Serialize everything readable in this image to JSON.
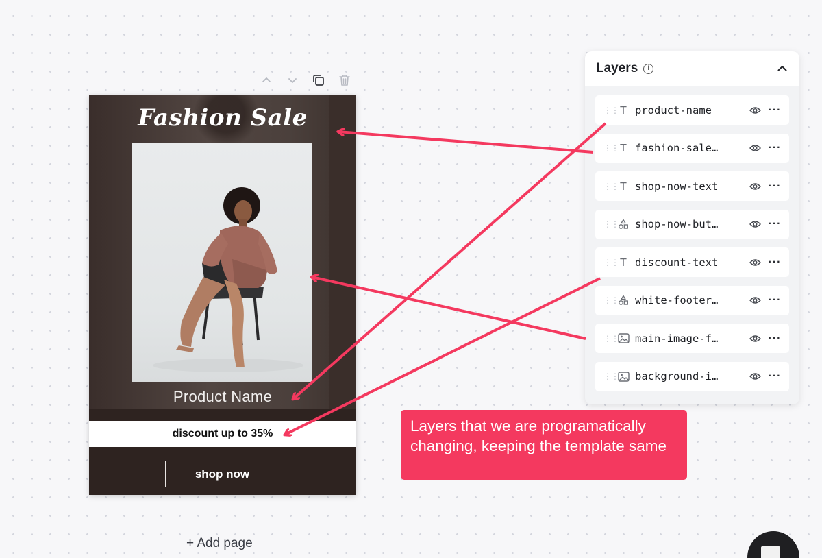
{
  "canvas": {
    "add_page_label": "+ Add page"
  },
  "design": {
    "title": "Fashion Sale",
    "product_name": "Product Name",
    "discount_text": "discount up to 35%",
    "button_label": "shop now"
  },
  "toolbar": {
    "icons": [
      "chevron-up-icon",
      "chevron-down-icon",
      "duplicate-icon",
      "trash-icon"
    ]
  },
  "layers": {
    "title": "Layers",
    "items": [
      {
        "type": "text",
        "name": "product-name"
      },
      {
        "type": "text",
        "name": "fashion-sale…"
      },
      {
        "type": "text",
        "name": "shop-now-text"
      },
      {
        "type": "shape",
        "name": "shop-now-but…"
      },
      {
        "type": "text",
        "name": "discount-text"
      },
      {
        "type": "shape",
        "name": "white-footer…"
      },
      {
        "type": "image",
        "name": "main-image-f…"
      },
      {
        "type": "image",
        "name": "background-i…"
      }
    ]
  },
  "callout": {
    "text": "Layers that we are programatically changing, keeping the template same"
  },
  "colors": {
    "accent": "#f4395f",
    "page_background": "#2e2320",
    "canvas_background": "#f7f7f9"
  }
}
